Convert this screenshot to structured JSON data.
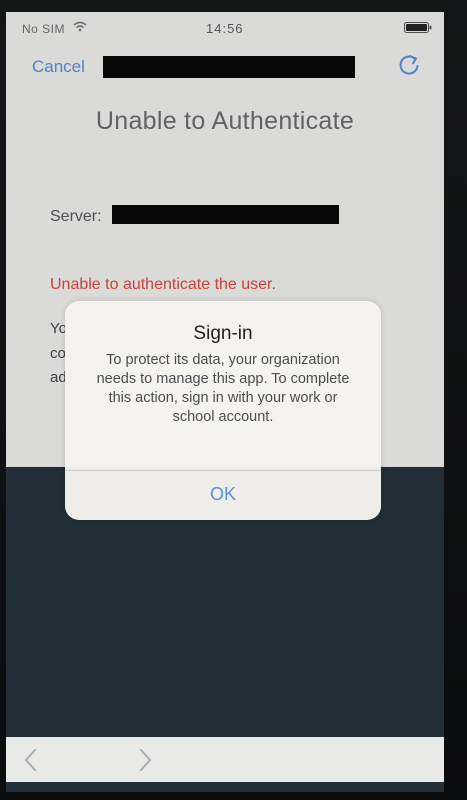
{
  "status_bar": {
    "carrier": "No SIM",
    "time": "14:56",
    "icons": [
      "wifi-icon",
      "battery-icon"
    ]
  },
  "nav": {
    "cancel_label": "Cancel",
    "refresh_icon": "refresh-icon"
  },
  "page": {
    "title": "Unable to Authenticate",
    "server_label": "Server:",
    "error_text": "Unable to authenticate the user.",
    "partial_lines": [
      "Yo",
      "co",
      "ad"
    ]
  },
  "dialog": {
    "title": "Sign-in",
    "message": "To protect its data, your organization needs to manage this app. To complete this action, sign in with your work or school account.",
    "ok_label": "OK"
  },
  "toolbar": {
    "icons": [
      "back-icon",
      "forward-icon"
    ]
  },
  "colors": {
    "accent": "#5b8fe0",
    "error": "#e4473b"
  }
}
